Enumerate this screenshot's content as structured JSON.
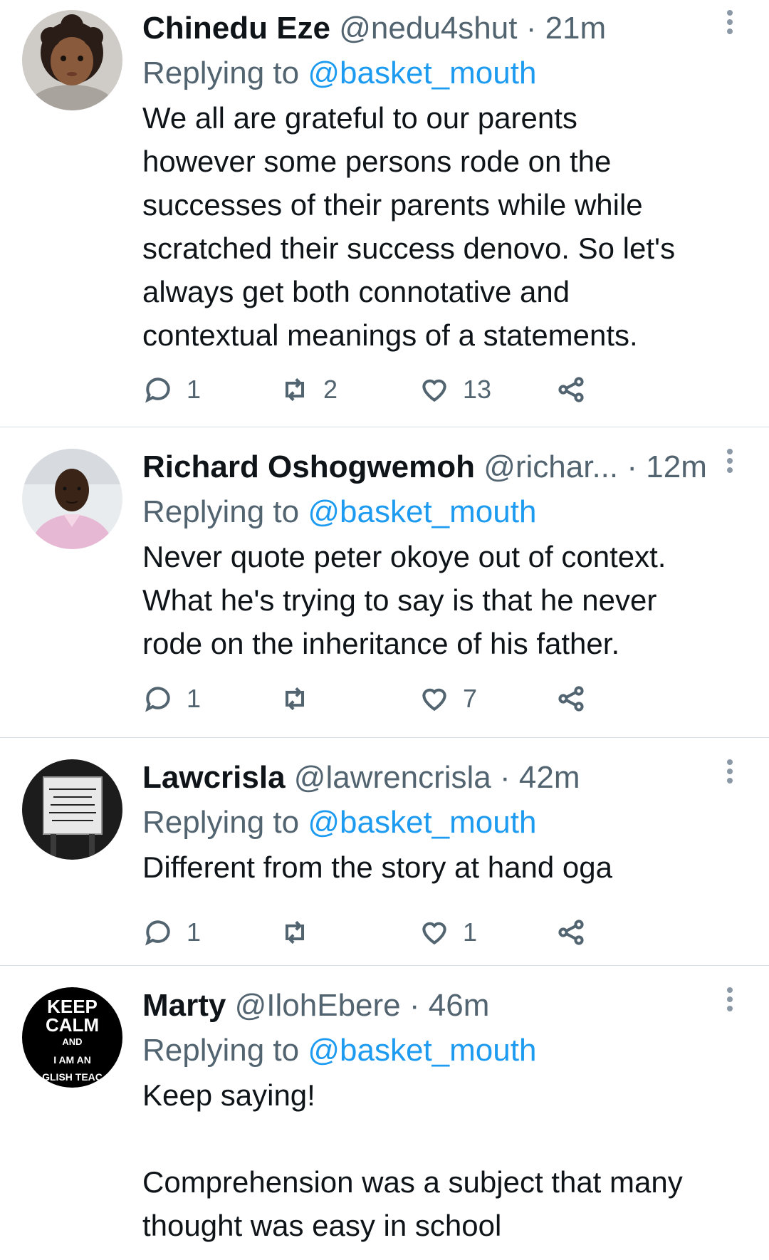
{
  "tweets": [
    {
      "name": "Chinedu Eze",
      "handle": "@nedu4shut",
      "dot": "·",
      "time": "21m",
      "replying_prefix": "Replying to",
      "replying_to": "@basket_mouth",
      "text": "We all are grateful to our parents\nhowever some persons rode on the\nsuccesses of their parents while while\nscratched their success denovo. So let's\nalways get both connotative and\ncontextual meanings of a statements.",
      "replies": "1",
      "retweets": "2",
      "likes": "13"
    },
    {
      "name": "Richard Oshogwemoh",
      "handle": "@richar...",
      "dot": "·",
      "time": "12m",
      "replying_prefix": "Replying to",
      "replying_to": "@basket_mouth",
      "text": "Never quote peter okoye out of context.\nWhat he's trying to say is that he never\nrode on the inheritance of his father.",
      "replies": "1",
      "retweets": "",
      "likes": "7"
    },
    {
      "name": "Lawcrisla",
      "handle": "@lawrencrisla",
      "dot": "·",
      "time": "42m",
      "replying_prefix": "Replying to",
      "replying_to": "@basket_mouth",
      "text": "Different from the story at hand oga",
      "replies": "1",
      "retweets": "",
      "likes": "1",
      "avatar_text": "TODAY WE DONT HAVE ANY MOTIVATIONAL QUOTES, IF YOU WANT TO GIVE UP, GIVE UP"
    },
    {
      "name": "Marty",
      "handle": "@IlohEbere",
      "dot": "·",
      "time": "46m",
      "replying_prefix": "Replying to",
      "replying_to": "@basket_mouth",
      "text": "Keep saying!\n\nComprehension was a subject that many\nthought was easy in school",
      "avatar_lines": [
        "KEEP",
        "CALM",
        "AND",
        "I AM AN",
        "GLISH TEAC"
      ]
    }
  ],
  "colors": {
    "link": "#1d9bf0",
    "secondary_text": "#536471",
    "primary_text": "#0f1419",
    "divider": "#d8dde1"
  },
  "icons": {
    "reply": "reply-icon",
    "retweet": "retweet-icon",
    "like": "heart-icon",
    "share": "share-icon",
    "more": "more-vertical-icon"
  }
}
